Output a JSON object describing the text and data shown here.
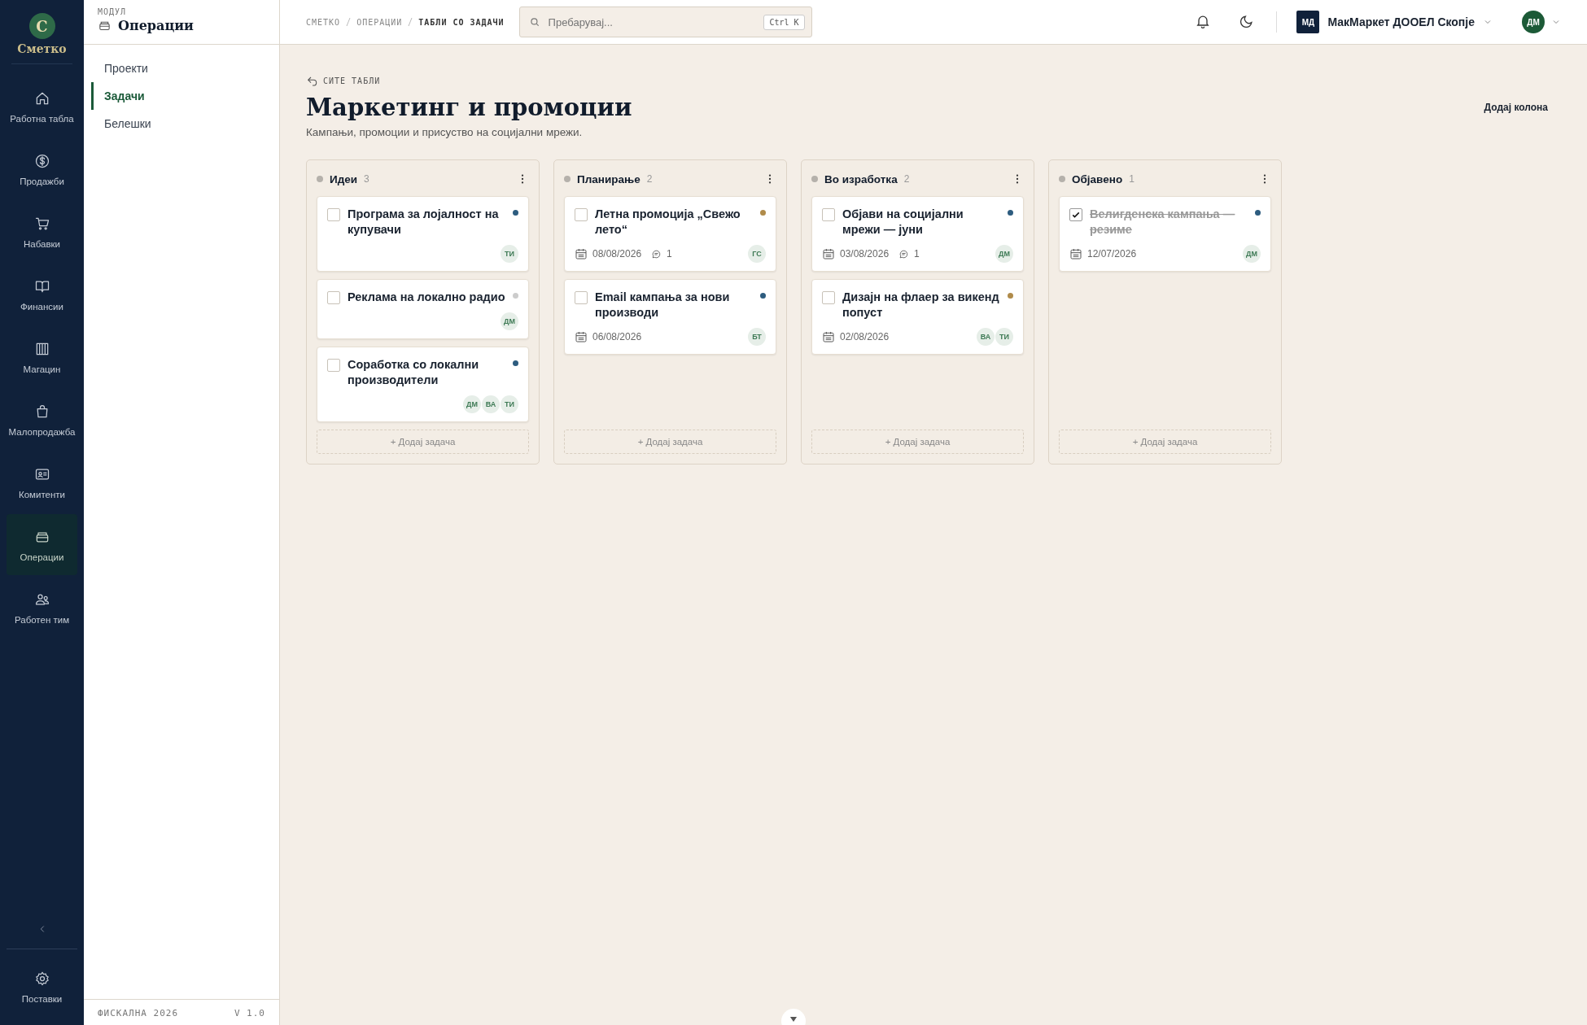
{
  "brand": {
    "letter": "С",
    "name": "Сметко"
  },
  "rail": [
    {
      "kind": "home",
      "label": "Работна табла",
      "selected": false
    },
    {
      "kind": "dollar",
      "label": "Продажби",
      "selected": false
    },
    {
      "kind": "cart",
      "label": "Набавки",
      "selected": false
    },
    {
      "kind": "book",
      "label": "Финансии",
      "selected": false
    },
    {
      "kind": "warehouse",
      "label": "Магацин",
      "selected": false
    },
    {
      "kind": "bag",
      "label": "Малопродажба",
      "selected": false
    },
    {
      "kind": "card",
      "label": "Комитенти",
      "selected": false
    },
    {
      "kind": "box",
      "label": "Операции",
      "selected": true
    },
    {
      "kind": "team",
      "label": "Работен тим",
      "selected": false
    }
  ],
  "settings": {
    "label": "Поставки"
  },
  "module": {
    "caption": "МОДУЛ",
    "title": "Операции"
  },
  "subnav": [
    {
      "label": "Проекти",
      "selected": false
    },
    {
      "label": "Задачи",
      "selected": true
    },
    {
      "label": "Белешки",
      "selected": false
    }
  ],
  "footer": {
    "year": "ФИСКАЛНА 2026",
    "version": "V 1.0"
  },
  "breadcrumb": [
    "СМЕТКО",
    "ОПЕРАЦИИ",
    "ТАБЛИ СО ЗАДАЧИ"
  ],
  "search": {
    "placeholder": "Пребарувај...",
    "shortcut": "Ctrl K"
  },
  "company": {
    "initials": "МД",
    "name": "МакМаркет ДООЕЛ Скопје"
  },
  "user": {
    "initials": "ДМ"
  },
  "back_link": "СИТЕ ТАБЛИ",
  "board": {
    "title": "Маркетинг и промоции",
    "description": "Кампањи, промоции и присуство на социјални мрежи.",
    "add_column": "Додај колона"
  },
  "columns": [
    {
      "title": "Идеи",
      "count": "3",
      "add_task": "+ Додај задача",
      "cards": [
        {
          "title": "Програма за лојалност на купувачи",
          "done": false,
          "color": "#2d5c7f",
          "assignees": [
            "ТИ"
          ]
        },
        {
          "title": "Реклама на локално радио",
          "done": false,
          "color": "#cccccc",
          "assignees": [
            "ДМ"
          ]
        },
        {
          "title": "Соработка со локални производители",
          "done": false,
          "color": "#2d5c7f",
          "assignees": [
            "ДМ",
            "ВА",
            "ТИ"
          ]
        }
      ]
    },
    {
      "title": "Планирање",
      "count": "2",
      "add_task": "+ Додај задача",
      "cards": [
        {
          "title": "Летна промоција „Свежо лето“",
          "done": false,
          "color": "#b08b4a",
          "date": "08/08/2026",
          "comments": "1",
          "assignees": [
            "ГС"
          ]
        },
        {
          "title": "Email кампања за нови производи",
          "done": false,
          "color": "#2d5c7f",
          "date": "06/08/2026",
          "assignees": [
            "БТ"
          ]
        }
      ]
    },
    {
      "title": "Во изработка",
      "count": "2",
      "add_task": "+ Додај задача",
      "cards": [
        {
          "title": "Објави на социјални мрежи — јуни",
          "done": false,
          "color": "#2d5c7f",
          "date": "03/08/2026",
          "comments": "1",
          "assignees": [
            "ДМ"
          ]
        },
        {
          "title": "Дизајн на флаер за викенд попуст",
          "done": false,
          "color": "#b08b4a",
          "date": "02/08/2026",
          "assignees": [
            "ВА",
            "ТИ"
          ]
        }
      ]
    },
    {
      "title": "Објавено",
      "count": "1",
      "add_task": "+ Додај задача",
      "cards": [
        {
          "title": "Велигденска кампања — резиме",
          "done": true,
          "color": "#2d5c7f",
          "date": "12/07/2026",
          "assignees": [
            "ДМ"
          ]
        }
      ]
    }
  ]
}
